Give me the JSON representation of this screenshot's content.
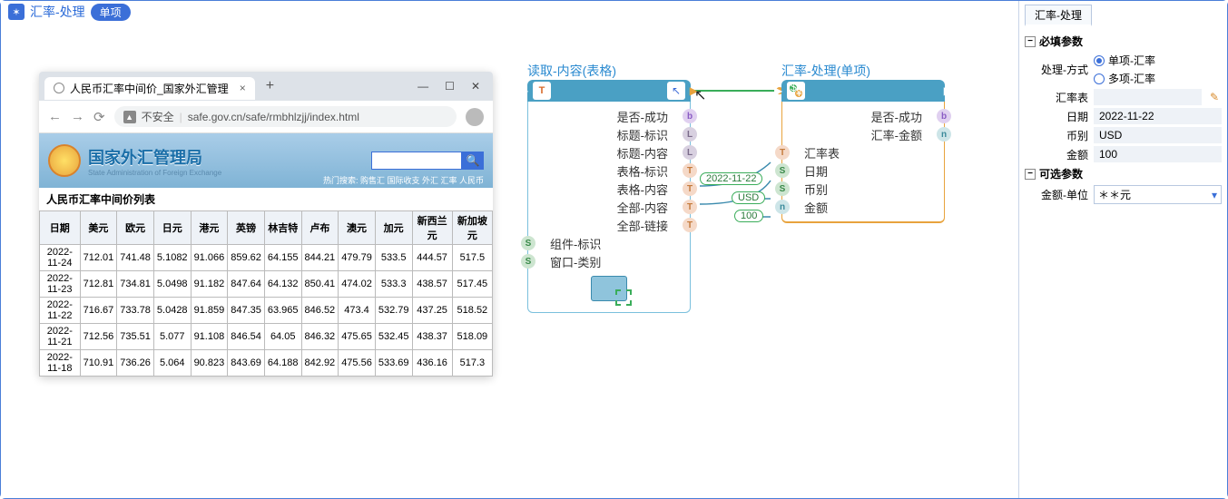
{
  "titlebar": {
    "title": "汇率-处理",
    "pill": "单项"
  },
  "browser": {
    "tab_title": "人民币汇率中间价_国家外汇管理",
    "url_warn": "不安全",
    "url": "safe.gov.cn/safe/rmbhlzjj/index.html",
    "hero_title": "国家外汇管理局",
    "hero_sub": "State Administration of Foreign Exchange",
    "hotlinks": "热门搜索: 购售汇 国际收支 外汇 汇率 人民币",
    "table_title": "人民币汇率中间价列表",
    "columns": [
      "日期",
      "美元",
      "欧元",
      "日元",
      "港元",
      "英镑",
      "林吉特",
      "卢布",
      "澳元",
      "加元",
      "新西兰元",
      "新加坡元"
    ],
    "rows": [
      [
        "2022-11-24",
        "712.01",
        "741.48",
        "5.1082",
        "91.066",
        "859.62",
        "64.155",
        "844.21",
        "479.79",
        "533.5",
        "444.57",
        "517.5"
      ],
      [
        "2022-11-23",
        "712.81",
        "734.81",
        "5.0498",
        "91.182",
        "847.64",
        "64.132",
        "850.41",
        "474.02",
        "533.3",
        "438.57",
        "517.45"
      ],
      [
        "2022-11-22",
        "716.67",
        "733.78",
        "5.0428",
        "91.859",
        "847.35",
        "63.965",
        "846.52",
        "473.4",
        "532.79",
        "437.25",
        "518.52"
      ],
      [
        "2022-11-21",
        "712.56",
        "735.51",
        "5.077",
        "91.108",
        "846.54",
        "64.05",
        "846.32",
        "475.65",
        "532.45",
        "438.37",
        "518.09"
      ],
      [
        "2022-11-18",
        "710.91",
        "736.26",
        "5.064",
        "90.823",
        "843.69",
        "64.188",
        "842.92",
        "475.56",
        "533.69",
        "436.16",
        "517.3"
      ]
    ]
  },
  "node1": {
    "title": "读取-内容(表格)",
    "outs": [
      {
        "label": "是否-成功",
        "t": "b"
      },
      {
        "label": "标题-标识",
        "t": "L"
      },
      {
        "label": "标题-内容",
        "t": "L"
      },
      {
        "label": "表格-标识",
        "t": "T"
      },
      {
        "label": "表格-内容",
        "t": "T"
      },
      {
        "label": "全部-内容",
        "t": "T"
      },
      {
        "label": "全部-链接",
        "t": "T"
      }
    ],
    "ins": [
      {
        "label": "组件-标识",
        "t": "S"
      },
      {
        "label": "窗口-类别",
        "t": "S"
      }
    ]
  },
  "tags": {
    "date": "2022-11-22",
    "curr": "USD",
    "amt": "100"
  },
  "node2": {
    "title": "汇率-处理(单项)",
    "outs": [
      {
        "label": "是否-成功",
        "t": "b"
      },
      {
        "label": "汇率-金额",
        "t": "n"
      }
    ],
    "ins": [
      {
        "label": "汇率表",
        "t": "T"
      },
      {
        "label": "日期",
        "t": "S"
      },
      {
        "label": "币别",
        "t": "S"
      },
      {
        "label": "金额",
        "t": "n"
      }
    ]
  },
  "panel": {
    "tab": "汇率-处理",
    "g1": "必填参数",
    "mode_label": "处理-方式",
    "mode_a": "单项-汇率",
    "mode_b": "多项-汇率",
    "table_label": "汇率表",
    "table_val": "",
    "date_label": "日期",
    "date_val": "2022-11-22",
    "curr_label": "币别",
    "curr_val": "USD",
    "amt_label": "金额",
    "amt_val": "100",
    "g2": "可选参数",
    "unit_label": "金额-单位",
    "unit_val": "＊＊元"
  },
  "chart_data": {
    "type": "table",
    "title": "人民币汇率中间价列表",
    "columns": [
      "日期",
      "美元",
      "欧元",
      "日元",
      "港元",
      "英镑",
      "林吉特",
      "卢布",
      "澳元",
      "加元",
      "新西兰元",
      "新加坡元"
    ],
    "rows": [
      [
        "2022-11-24",
        712.01,
        741.48,
        5.1082,
        91.066,
        859.62,
        64.155,
        844.21,
        479.79,
        533.5,
        444.57,
        517.5
      ],
      [
        "2022-11-23",
        712.81,
        734.81,
        5.0498,
        91.182,
        847.64,
        64.132,
        850.41,
        474.02,
        533.3,
        438.57,
        517.45
      ],
      [
        "2022-11-22",
        716.67,
        733.78,
        5.0428,
        91.859,
        847.35,
        63.965,
        846.52,
        473.4,
        532.79,
        437.25,
        518.52
      ],
      [
        "2022-11-21",
        712.56,
        735.51,
        5.077,
        91.108,
        846.54,
        64.05,
        846.32,
        475.65,
        532.45,
        438.37,
        518.09
      ],
      [
        "2022-11-18",
        710.91,
        736.26,
        5.064,
        90.823,
        843.69,
        64.188,
        842.92,
        475.56,
        533.69,
        436.16,
        517.3
      ]
    ]
  }
}
